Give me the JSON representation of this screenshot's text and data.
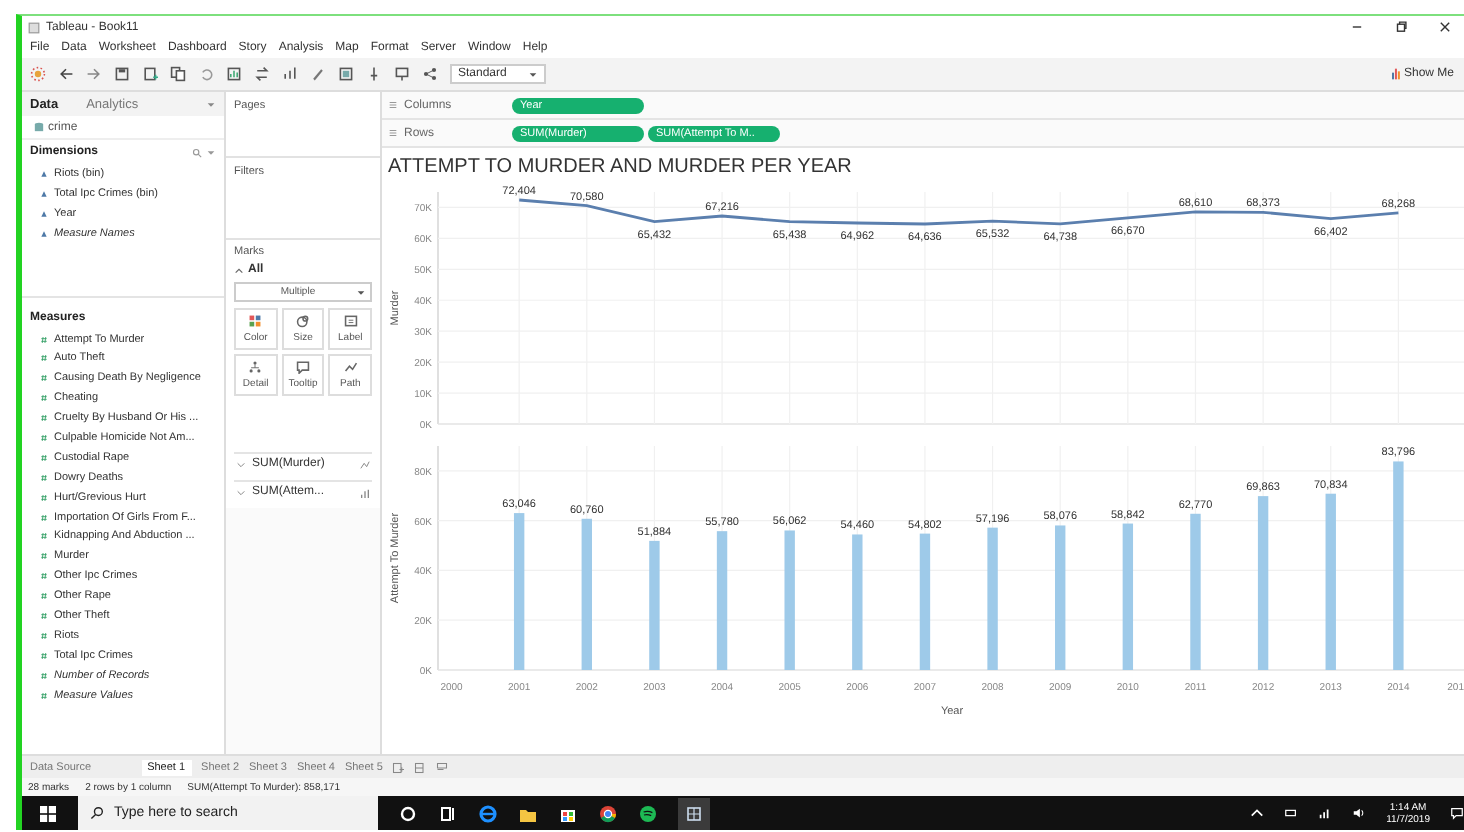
{
  "window": {
    "title": "Tableau - Book11"
  },
  "menu": [
    "File",
    "Data",
    "Worksheet",
    "Dashboard",
    "Story",
    "Analysis",
    "Map",
    "Format",
    "Server",
    "Window",
    "Help"
  ],
  "toolbar": {
    "view_mode": "Standard",
    "show_me": "Show Me"
  },
  "data_pane": {
    "tabs": [
      {
        "label": "Data",
        "selected": true
      },
      {
        "label": "Analytics",
        "selected": false
      }
    ],
    "source": "crime",
    "dimensions": {
      "title": "Dimensions",
      "items": [
        {
          "label": "Riots (bin)",
          "kind": "field"
        },
        {
          "label": "Total Ipc Crimes (bin)",
          "kind": "field"
        },
        {
          "label": "Year",
          "kind": "field"
        },
        {
          "label": "Measure Names",
          "kind": "generated"
        }
      ]
    },
    "measures": {
      "title": "Measures",
      "items": [
        {
          "label": "Attempt To Murder",
          "kind": "field"
        },
        {
          "label": "Auto Theft",
          "kind": "field"
        },
        {
          "label": "Causing Death By Negligence",
          "kind": "field"
        },
        {
          "label": "Cheating",
          "kind": "field"
        },
        {
          "label": "Cruelty By Husband Or His ...",
          "kind": "field"
        },
        {
          "label": "Culpable Homicide Not Am...",
          "kind": "field"
        },
        {
          "label": "Custodial Rape",
          "kind": "field"
        },
        {
          "label": "Dowry Deaths",
          "kind": "field"
        },
        {
          "label": "Hurt/Grevious Hurt",
          "kind": "field"
        },
        {
          "label": "Importation Of Girls From F...",
          "kind": "field"
        },
        {
          "label": "Kidnapping And Abduction ...",
          "kind": "field"
        },
        {
          "label": "Murder",
          "kind": "field"
        },
        {
          "label": "Other Ipc Crimes",
          "kind": "field"
        },
        {
          "label": "Other Rape",
          "kind": "field"
        },
        {
          "label": "Other Theft",
          "kind": "field"
        },
        {
          "label": "Riots",
          "kind": "field"
        },
        {
          "label": "Total Ipc Crimes",
          "kind": "field"
        },
        {
          "label": "Number of Records",
          "kind": "generated"
        },
        {
          "label": "Measure Values",
          "kind": "generated"
        }
      ]
    }
  },
  "pages": {
    "title": "Pages"
  },
  "filters": {
    "title": "Filters"
  },
  "marks": {
    "title": "Marks",
    "all": "All",
    "mark_type": "Multiple",
    "buttons": [
      "Color",
      "Size",
      "Label",
      "Detail",
      "Tooltip",
      "Path"
    ],
    "cards": [
      {
        "label": "SUM(Murder)",
        "kind": "line"
      },
      {
        "label": "SUM(Attem...",
        "kind": "bar"
      }
    ]
  },
  "shelves": [
    {
      "label": "Columns",
      "pills": [
        "Year"
      ]
    },
    {
      "label": "Rows",
      "pills": [
        "SUM(Murder)",
        "SUM(Attempt To M.."
      ]
    }
  ],
  "sheet": {
    "title": "ATTEMPT TO MURDER AND MURDER PER YEAR",
    "charts": [
      {
        "chart_data": {
          "type": "line",
          "ylabel": "Murder",
          "x": [
            2001,
            2002,
            2003,
            2004,
            2005,
            2006,
            2007,
            2008,
            2009,
            2010,
            2011,
            2012,
            2013,
            2014
          ],
          "series": [
            {
              "color": "#5b7fae",
              "values": [
                72404,
                70580,
                65432,
                67216,
                65438,
                64962,
                64636,
                65532,
                64738,
                66670,
                68610,
                68373,
                66402,
                68268
              ]
            }
          ],
          "xlim": [
            1999.8,
            2015
          ],
          "ylim": [
            0,
            75000
          ],
          "yticks": [
            {
              "value": 70000,
              "label": "70K"
            },
            {
              "value": 60000,
              "label": "60K"
            },
            {
              "value": 50000,
              "label": "50K"
            },
            {
              "value": 40000,
              "label": "40K"
            },
            {
              "value": 30000,
              "label": "30K"
            },
            {
              "value": 20000,
              "label": "20K"
            },
            {
              "value": 10000,
              "label": "10K"
            },
            {
              "value": 0,
              "label": "0K"
            }
          ],
          "grid": true,
          "value_labels": [
            "72,404",
            "70,580",
            "65,432",
            "67,216",
            "65,438",
            "64,962",
            "64,636",
            "65,532",
            "64,738",
            "66,670",
            "68,610",
            "68,373",
            "66,402",
            "68,268"
          ]
        }
      },
      {
        "chart_data": {
          "type": "bar",
          "xlabel": "Year",
          "ylabel": "Attempt To Murder",
          "x": [
            2001,
            2002,
            2003,
            2004,
            2005,
            2006,
            2007,
            2008,
            2009,
            2010,
            2011,
            2012,
            2013,
            2014
          ],
          "series": [
            {
              "color": "#9ecae9",
              "values": [
                63046,
                60760,
                51884,
                55780,
                56062,
                54460,
                54802,
                57196,
                58076,
                58842,
                62770,
                69863,
                70834,
                83796
              ]
            }
          ],
          "xlim": [
            1999.8,
            2015
          ],
          "ylim": [
            0,
            90000
          ],
          "xticks": [
            2000,
            2001,
            2002,
            2003,
            2004,
            2005,
            2006,
            2007,
            2008,
            2009,
            2010,
            2011,
            2012,
            2013,
            2014
          ],
          "yticks": [
            {
              "value": 80000,
              "label": "80K"
            },
            {
              "value": 60000,
              "label": "60K"
            },
            {
              "value": 40000,
              "label": "40K"
            },
            {
              "value": 20000,
              "label": "20K"
            },
            {
              "value": 0,
              "label": "0K"
            }
          ],
          "grid": true,
          "value_labels": [
            "63,046",
            "60,760",
            "51,884",
            "55,780",
            "56,062",
            "54,460",
            "54,802",
            "57,196",
            "58,076",
            "58,842",
            "62,770",
            "69,863",
            "70,834",
            "83,796"
          ]
        },
        "cut_tick_label": "201"
      }
    ]
  },
  "sheet_tabs": {
    "data_source": "Data Source",
    "tabs": [
      {
        "label": "Sheet 1",
        "selected": true
      },
      {
        "label": "Sheet 2",
        "selected": false
      },
      {
        "label": "Sheet 3",
        "selected": false
      },
      {
        "label": "Sheet 4",
        "selected": false
      },
      {
        "label": "Sheet 5",
        "selected": false
      }
    ]
  },
  "status_bar": [
    "28 marks",
    "2 rows by 1 column",
    "SUM(Attempt To Murder): 858,171"
  ],
  "taskbar": {
    "search_placeholder": "Type here to search",
    "time": "1:14 AM",
    "date": "11/7/2019"
  }
}
